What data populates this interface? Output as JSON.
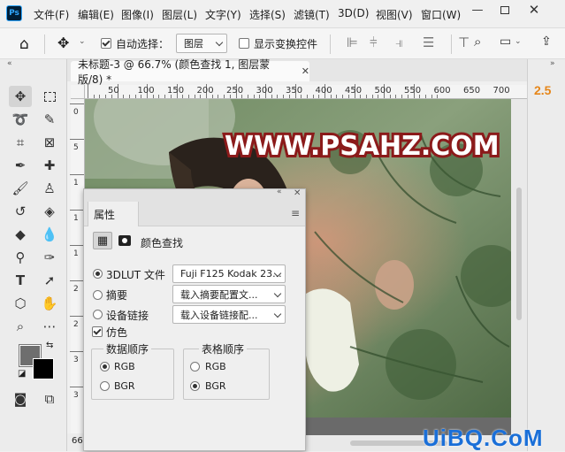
{
  "menubar": {
    "logo": "Ps",
    "items": [
      "文件(F)",
      "编辑(E)",
      "图像(I)",
      "图层(L)",
      "文字(Y)",
      "选择(S)",
      "滤镜(T)",
      "3D(D)",
      "视图(V)",
      "窗口(W)"
    ]
  },
  "optionsbar": {
    "auto_select_label": "自动选择：",
    "auto_select_value": "图层",
    "show_transform_label": "显示变换控件"
  },
  "document": {
    "tab_title": "未标题-3 @ 66.7% (颜色查找 1, 图层蒙版/8) *",
    "ruler_ticks": [
      "50",
      "100",
      "150",
      "200",
      "250",
      "300",
      "350",
      "400",
      "450",
      "500",
      "550",
      "600",
      "650",
      "700"
    ],
    "vruler_ticks": [
      "0",
      "5",
      "1",
      "1",
      "1",
      "2",
      "2",
      "3",
      "3"
    ],
    "status_zoom": "66",
    "watermark": "WWW.PSAHZ.COM"
  },
  "rightstrip": {
    "zoom_value": "2.5"
  },
  "properties": {
    "tab_label": "属性",
    "adjustment_title": "颜色查找",
    "options": [
      {
        "label": "3DLUT 文件",
        "selected": true,
        "value": "Fuji F125 Kodak 23..."
      },
      {
        "label": "摘要",
        "selected": false,
        "value": "载入摘要配置文..."
      },
      {
        "label": "设备链接",
        "selected": false,
        "value": "载入设备链接配..."
      }
    ],
    "dither_label": "仿色",
    "data_order": {
      "title": "数据顺序",
      "options": [
        {
          "label": "RGB",
          "selected": true
        },
        {
          "label": "BGR",
          "selected": false
        }
      ]
    },
    "table_order": {
      "title": "表格顺序",
      "options": [
        {
          "label": "RGB",
          "selected": false
        },
        {
          "label": "BGR",
          "selected": true
        }
      ]
    }
  },
  "footer_watermark": "UiBQ.CoM",
  "colors": {
    "accent_orange": "#e68619",
    "watermark_red": "#8b1a1a",
    "brand_blue": "#1a6fd8",
    "foreground": "#6e6e6e",
    "background": "#000000"
  }
}
